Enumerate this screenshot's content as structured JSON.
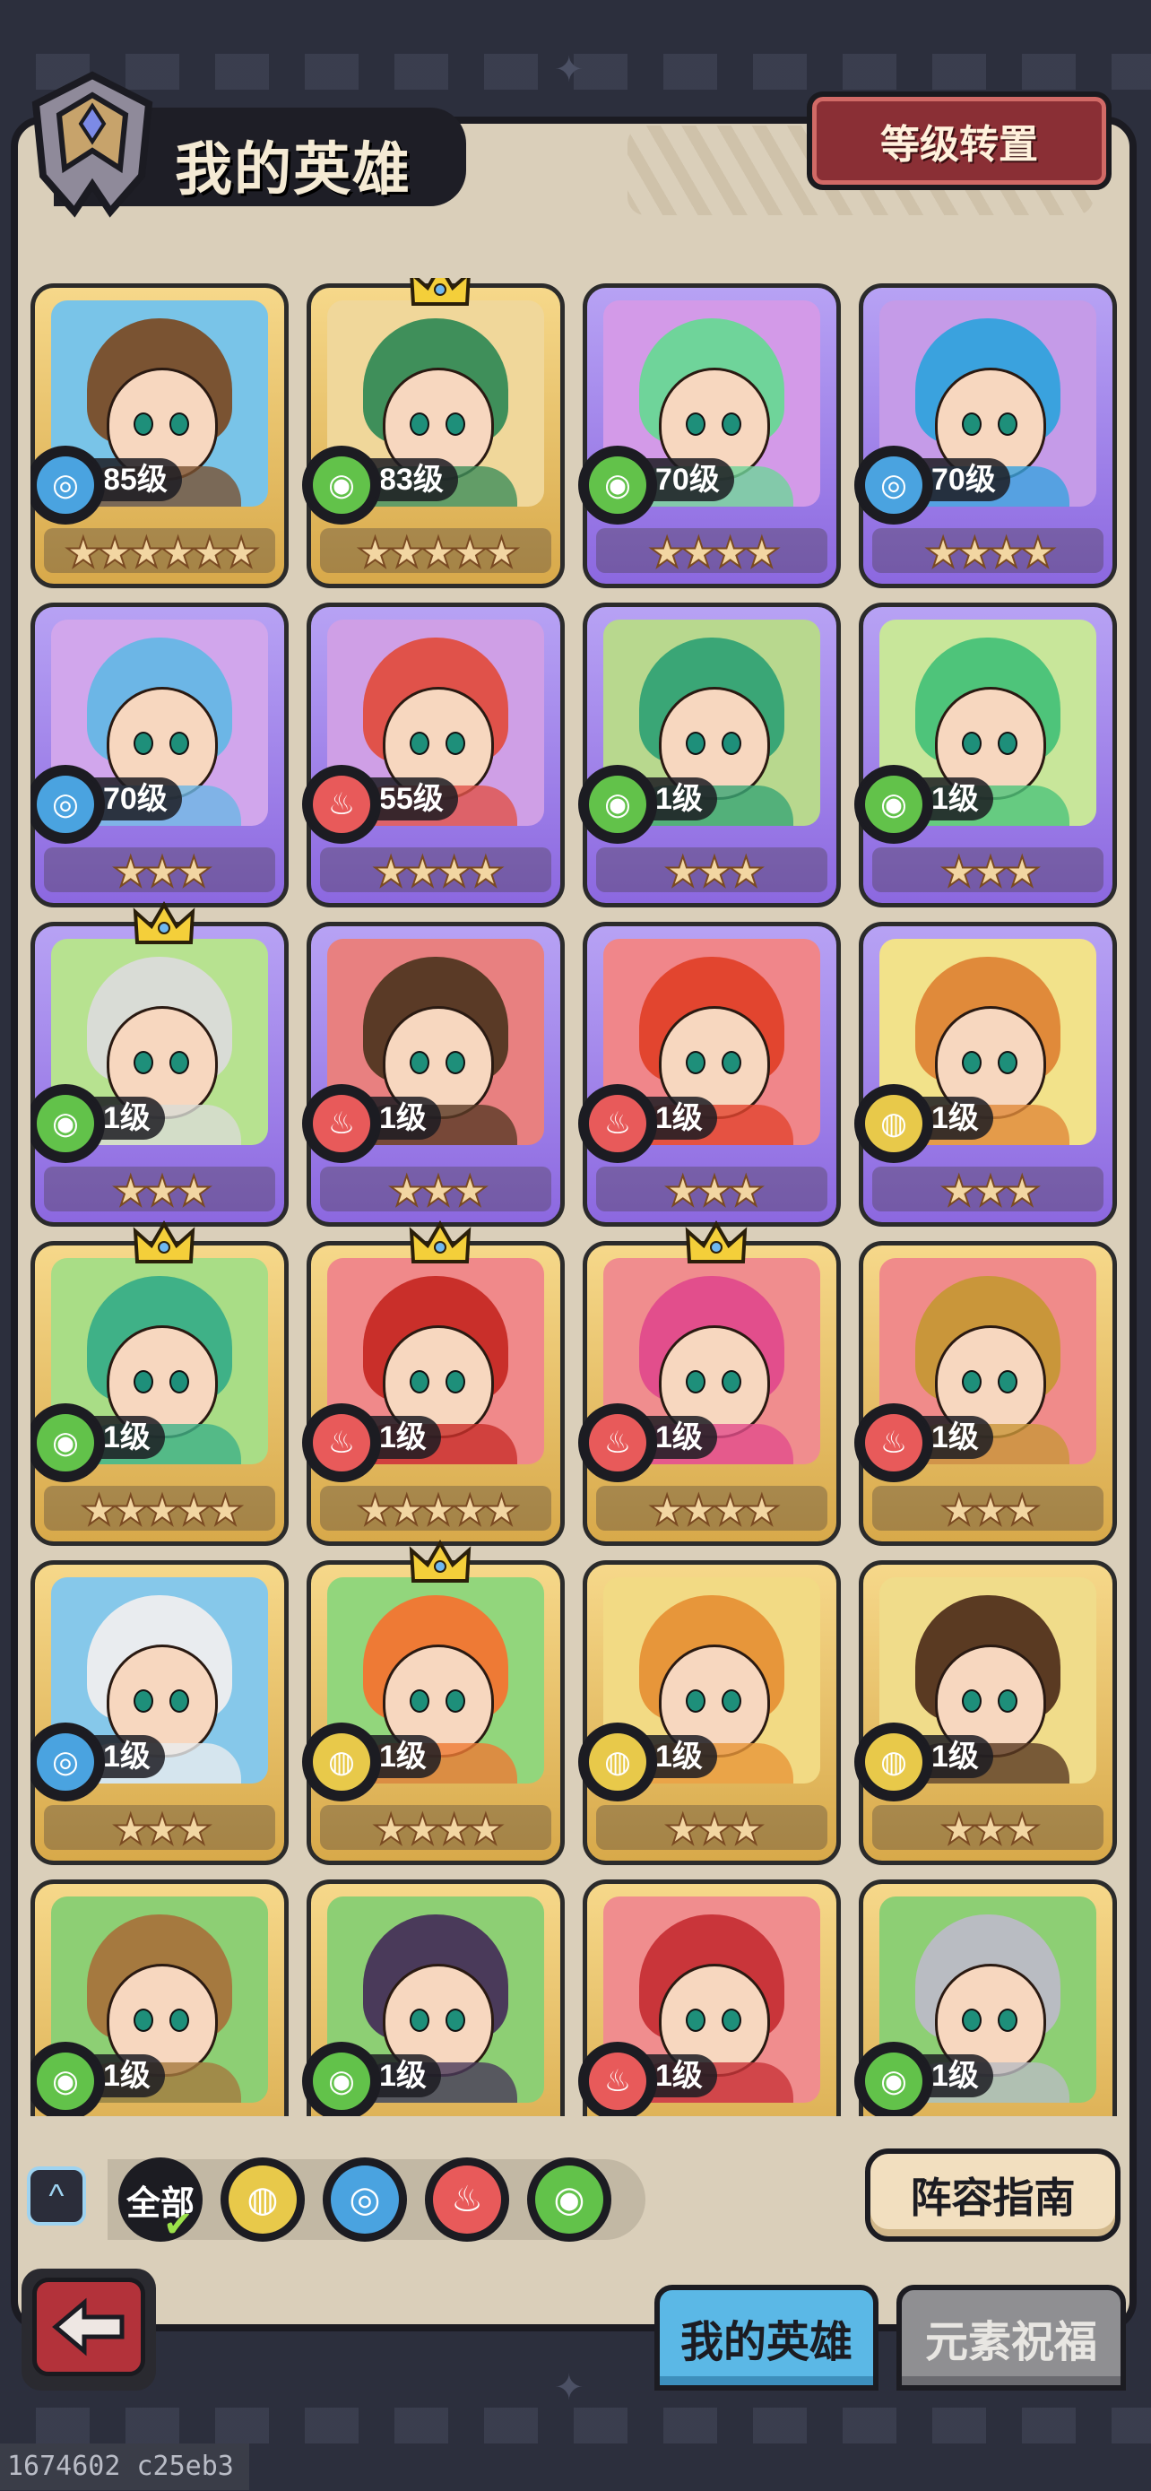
{
  "header": {
    "title": "我的英雄",
    "level_transfer_label": "等级转置"
  },
  "heroes": [
    {
      "level": "85级",
      "element": "water",
      "stars": "★★★★★★",
      "frame": "gold",
      "crown": false,
      "hair": "#7a5332",
      "bg": "#79c4e8"
    },
    {
      "level": "83级",
      "element": "wood",
      "stars": "★★★★★",
      "frame": "gold",
      "crown": true,
      "hair": "#3f8f5a",
      "bg": "#f0d79a"
    },
    {
      "level": "70级",
      "element": "wood",
      "stars": "★★★★",
      "frame": "purple",
      "crown": false,
      "hair": "#6fd49a",
      "bg": "#d39ae8"
    },
    {
      "level": "70级",
      "element": "water",
      "stars": "★★★★",
      "frame": "purple",
      "crown": false,
      "hair": "#3aa2de",
      "bg": "#c59be8"
    },
    {
      "level": "70级",
      "element": "water",
      "stars": "★★★",
      "frame": "purple",
      "crown": false,
      "hair": "#6cb6e6",
      "bg": "#d1a6ec"
    },
    {
      "level": "55级",
      "element": "fire",
      "stars": "★★★★",
      "frame": "purple",
      "crown": false,
      "hair": "#e0524a",
      "bg": "#cf9fe6"
    },
    {
      "level": "1级",
      "element": "wood",
      "stars": "★★★",
      "frame": "purple",
      "crown": false,
      "hair": "#3aa676",
      "bg": "#b8d88e"
    },
    {
      "level": "1级",
      "element": "wood",
      "stars": "★★★",
      "frame": "purple",
      "crown": false,
      "hair": "#4ec47a",
      "bg": "#c8e69a"
    },
    {
      "level": "1级",
      "element": "wood",
      "stars": "★★★",
      "frame": "purple",
      "crown": true,
      "hair": "#d9dcd6",
      "bg": "#b7e290"
    },
    {
      "level": "1级",
      "element": "fire",
      "stars": "★★★",
      "frame": "purple",
      "crown": false,
      "hair": "#5a3a26",
      "bg": "#e88080"
    },
    {
      "level": "1级",
      "element": "fire",
      "stars": "★★★",
      "frame": "purple",
      "crown": false,
      "hair": "#e2452f",
      "bg": "#f0868a"
    },
    {
      "level": "1级",
      "element": "earth",
      "stars": "★★★",
      "frame": "purple",
      "crown": false,
      "hair": "#e08a3a",
      "bg": "#f2e28a"
    },
    {
      "level": "1级",
      "element": "wood",
      "stars": "★★★★★",
      "frame": "gold",
      "crown": true,
      "hair": "#3fb187",
      "bg": "#a9dd86"
    },
    {
      "level": "1级",
      "element": "fire",
      "stars": "★★★★★",
      "frame": "gold",
      "crown": true,
      "hair": "#c92f2a",
      "bg": "#f0898a"
    },
    {
      "level": "1级",
      "element": "fire",
      "stars": "★★★★",
      "frame": "gold",
      "crown": true,
      "hair": "#e24e8c",
      "bg": "#f08d8e"
    },
    {
      "level": "1级",
      "element": "fire",
      "stars": "★★★",
      "frame": "gold",
      "crown": false,
      "hair": "#c9963a",
      "bg": "#f08b8a"
    },
    {
      "level": "1级",
      "element": "water",
      "stars": "★★★",
      "frame": "gold",
      "crown": false,
      "hair": "#e9ecef",
      "bg": "#86c8ea"
    },
    {
      "level": "1级",
      "element": "earth",
      "stars": "★★★★",
      "frame": "gold",
      "crown": true,
      "hair": "#ee7a35",
      "bg": "#92d67c"
    },
    {
      "level": "1级",
      "element": "earth",
      "stars": "★★★",
      "frame": "gold",
      "crown": false,
      "hair": "#e7963a",
      "bg": "#f2da84"
    },
    {
      "level": "1级",
      "element": "earth",
      "stars": "★★★",
      "frame": "gold",
      "crown": false,
      "hair": "#5a3a22",
      "bg": "#f0dc8a"
    },
    {
      "level": "1级",
      "element": "wood",
      "stars": "★★★",
      "frame": "gold",
      "crown": false,
      "hair": "#a5793f",
      "bg": "#8dcf74"
    },
    {
      "level": "1级",
      "element": "wood",
      "stars": "★★★",
      "frame": "gold",
      "crown": false,
      "hair": "#4a3a5a",
      "bg": "#8dcf74"
    },
    {
      "level": "1级",
      "element": "fire",
      "stars": "★★★",
      "frame": "gold",
      "crown": false,
      "hair": "#c9353a",
      "bg": "#f08d8e"
    },
    {
      "level": "1级",
      "element": "wood",
      "stars": "★★★",
      "frame": "gold",
      "crown": false,
      "hair": "#b9bcc2",
      "bg": "#8dcf74"
    }
  ],
  "elements": {
    "water": {
      "color": "#4aa3e0",
      "glyph": "◎"
    },
    "wood": {
      "color": "#62c24a",
      "glyph": "◉"
    },
    "fire": {
      "color": "#e85a5a",
      "glyph": "♨"
    },
    "earth": {
      "color": "#e8c94a",
      "glyph": "◍"
    }
  },
  "filter": {
    "all_label": "全部",
    "chips": [
      "earth",
      "water",
      "fire",
      "wood"
    ]
  },
  "buttons": {
    "lineup_guide": "阵容指南"
  },
  "tabs": {
    "my_heroes": "我的英雄",
    "element_blessing": "元素祝福"
  },
  "watermark": "1674602 c25eb3"
}
